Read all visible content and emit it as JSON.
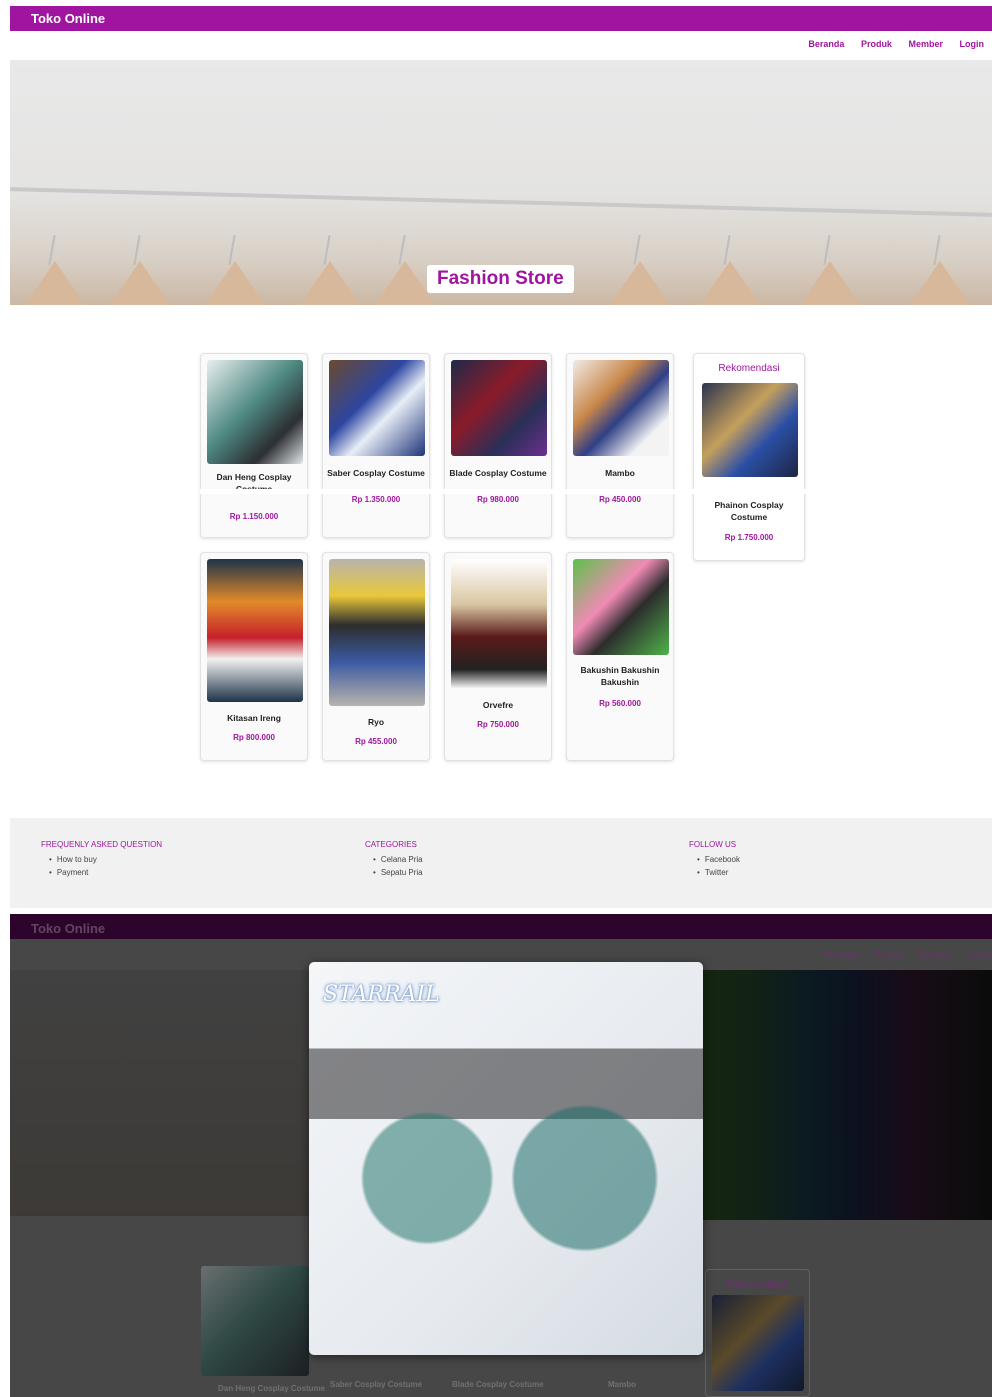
{
  "app": {
    "title": "Toko Online"
  },
  "nav": {
    "items": [
      "Beranda",
      "Produk",
      "Member",
      "Login"
    ]
  },
  "hero": {
    "title": "Fashion Store"
  },
  "products": [
    {
      "name": "Dan Heng Cosplay Costume",
      "price": "Rp 1.150.000"
    },
    {
      "name": "Saber Cosplay Costume",
      "price": "Rp 1.350.000"
    },
    {
      "name": "Blade Cosplay Costume",
      "price": "Rp 980.000"
    },
    {
      "name": "Mambo",
      "price": "Rp 450.000"
    },
    {
      "name": "Kitasan Ireng",
      "price": "Rp 800.000"
    },
    {
      "name": "Ryo",
      "price": "Rp 455.000"
    },
    {
      "name": "Orvefre",
      "price": "Rp 750.000"
    },
    {
      "name": "Bakushin Bakushin Bakushin",
      "price": "Rp 560.000"
    }
  ],
  "recommendation": {
    "title": "Rekomendasi",
    "name": "Phainon Cosplay Costume",
    "price": "Rp 1.750.000"
  },
  "footer": {
    "faq": {
      "title": "FREQUENLY ASKED QUESTION",
      "items": [
        "How to buy",
        "Payment"
      ]
    },
    "categories": {
      "title": "CATEGORIES",
      "items": [
        "Celana Pria",
        "Sepatu Pria"
      ]
    },
    "follow": {
      "title": "FOLLOW US",
      "items": [
        "Facebook",
        "Twitter"
      ]
    }
  },
  "modal": {
    "logo": "STARRAIL"
  },
  "colors": {
    "accent": "#a0159f",
    "footer_bg": "#f1f1f1",
    "overlay": "rgba(0,0,0,0.72)"
  }
}
